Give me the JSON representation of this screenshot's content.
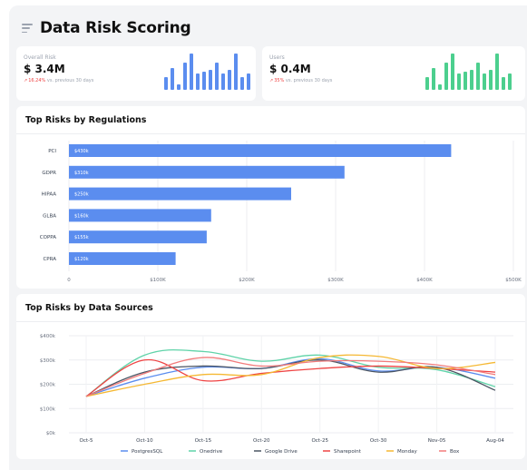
{
  "page": {
    "title": "Data Risk Scoring"
  },
  "kpis": [
    {
      "label": "Overall Risk",
      "value": "$ 3.4M",
      "delta": "16.24%",
      "suffix": "vs. previous 30 days",
      "color": "#5b8def",
      "bars": [
        14,
        24,
        6,
        30,
        40,
        18,
        20,
        22,
        30,
        18,
        22,
        40,
        14,
        18
      ]
    },
    {
      "label": "Users",
      "value": "$ 0.4M",
      "delta": "35%",
      "suffix": "vs. previous 30 days",
      "color": "#4ccf8e",
      "bars": [
        14,
        24,
        6,
        30,
        40,
        18,
        20,
        22,
        30,
        18,
        22,
        40,
        14,
        18
      ]
    }
  ],
  "regulations": {
    "title": "Top Risks by Regulations",
    "chart_data": {
      "type": "bar",
      "orientation": "horizontal",
      "categories": [
        "PCI",
        "GDPR",
        "HIPAA",
        "GLBA",
        "COPPA",
        "CPRA"
      ],
      "values": [
        430,
        310,
        250,
        160,
        155,
        120
      ],
      "data_labels": [
        "$430k",
        "$310k",
        "$250k",
        "$160k",
        "$155k",
        "$120k"
      ],
      "x_ticks": [
        "0",
        "$100K",
        "$200K",
        "$300K",
        "$400K",
        "$500K"
      ],
      "xlim": [
        0,
        500
      ],
      "bar_color": "#5b8def"
    }
  },
  "sources": {
    "title": "Top Risks by Data Sources",
    "chart_data": {
      "type": "line",
      "x": [
        "Oct-5",
        "Oct-10",
        "Oct-15",
        "Oct-20",
        "Oct-25",
        "Oct-30",
        "Nov-05",
        "Aug-04"
      ],
      "y_ticks": [
        "$0k",
        "$100k",
        "$200k",
        "$300k",
        "$400k"
      ],
      "ylim": [
        0,
        400
      ],
      "series": [
        {
          "name": "PostgresSQL",
          "color": "#5b8def",
          "values": [
            150,
            225,
            270,
            265,
            305,
            255,
            270,
            225
          ]
        },
        {
          "name": "Onedrive",
          "color": "#5fd3a8",
          "values": [
            150,
            320,
            335,
            295,
            320,
            270,
            260,
            190
          ]
        },
        {
          "name": "Google Drive",
          "color": "#4b5563",
          "values": [
            150,
            250,
            275,
            265,
            300,
            250,
            270,
            175
          ]
        },
        {
          "name": "Sharepoint",
          "color": "#ef4444",
          "values": [
            150,
            300,
            215,
            245,
            265,
            275,
            265,
            250
          ]
        },
        {
          "name": "Monday",
          "color": "#f5b833",
          "values": [
            150,
            200,
            240,
            240,
            310,
            315,
            265,
            290
          ]
        },
        {
          "name": "Box",
          "color": "#f27b7b",
          "values": [
            150,
            245,
            310,
            275,
            295,
            295,
            280,
            240
          ]
        }
      ]
    }
  }
}
